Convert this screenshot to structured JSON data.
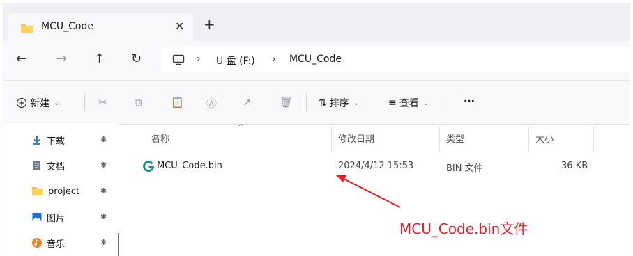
{
  "tab": {
    "title": "MCU_Code",
    "close_glyph": "✕",
    "new_tab_glyph": "+"
  },
  "nav": {
    "back_glyph": "←",
    "forward_glyph": "→",
    "up_glyph": "↑",
    "refresh_glyph": "↻",
    "address_crumbs": [
      "U 盘 (F:)",
      "MCU_Code"
    ],
    "crumb_separator": "›"
  },
  "commands": {
    "new_label": "新建",
    "sort_label": "排序",
    "view_label": "查看",
    "more_glyph": "···",
    "chevron_glyph": "⌄"
  },
  "sidebar": {
    "items": [
      {
        "label": "下载",
        "icon": "download-icon"
      },
      {
        "label": "文档",
        "icon": "document-icon"
      },
      {
        "label": "project",
        "icon": "folder-icon"
      },
      {
        "label": "图片",
        "icon": "pictures-icon"
      },
      {
        "label": "音乐",
        "icon": "music-icon"
      }
    ],
    "pin_glyph": "📌"
  },
  "filelist": {
    "columns": [
      "名称",
      "修改日期",
      "类型",
      "大小"
    ],
    "sort_caret": "^",
    "rows": [
      {
        "name": "MCU_Code.bin",
        "modified": "2024/4/12 15:53",
        "type": "BIN 文件",
        "size": "36 KB",
        "icon": "bin-file-icon"
      }
    ]
  },
  "annotation": {
    "text": "MCU_Code.bin文件",
    "color": "#ee1d24"
  }
}
